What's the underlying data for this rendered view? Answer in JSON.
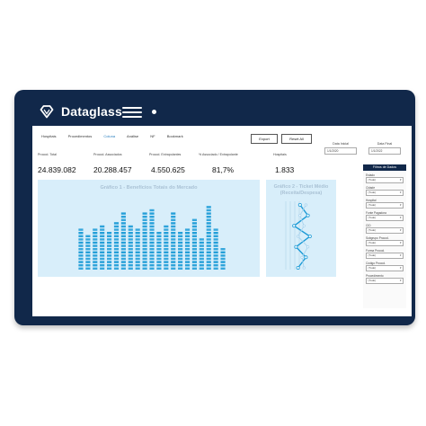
{
  "header": {
    "brand": "Dataglass"
  },
  "nav": {
    "items": [
      "Hospitais",
      "Procedimentos",
      "Coluna",
      "Análise",
      "NF",
      "Bookmark"
    ]
  },
  "toolbar": {
    "export_label": "Export",
    "reset_label": "Reset All"
  },
  "dates": {
    "start": {
      "label": "Data Inicial",
      "value": "1/1/2020"
    },
    "end": {
      "label": "Data Final",
      "value": "1/1/2022"
    }
  },
  "kpis": [
    {
      "label": "Procod. Total",
      "value": "24.839.082"
    },
    {
      "label": "Procod. Associados",
      "value": "20.288.457"
    },
    {
      "label": "Procod. Extrapolantes",
      "value": "4.550.625"
    },
    {
      "label": "% Associado / Extrapolante",
      "value": "81,7%"
    },
    {
      "label": "Hospitais",
      "value": "1.833"
    }
  ],
  "chart_data": [
    {
      "type": "bar",
      "title": "Gráfico 1 - Benefícios Totais do Mercado",
      "values": [
        16,
        13,
        15,
        17,
        14,
        18,
        22,
        17,
        15,
        21,
        23,
        14,
        17,
        21,
        14,
        16,
        19,
        12,
        24,
        15,
        8
      ],
      "ylim": [
        0,
        26
      ]
    },
    {
      "type": "line",
      "title": "Gráfico 2 - Ticket Médio (Receita/Despesa)",
      "series": [
        {
          "values": [
            0.45,
            0.65,
            0.3,
            0.7,
            0.35,
            0.6,
            0.4
          ]
        },
        {
          "values": [
            0.6,
            0.45,
            0.55,
            0.4,
            0.65,
            0.5,
            0.55
          ]
        }
      ],
      "ylim": [
        0,
        1
      ]
    }
  ],
  "filters": {
    "title": "Filtros de Dados",
    "items": [
      {
        "label": "Estado",
        "value": "(Tudo)"
      },
      {
        "label": "Cidade",
        "value": "(Tudo)"
      },
      {
        "label": "Hospital",
        "value": "(Tudo)"
      },
      {
        "label": "Fonte Pagadora",
        "value": "(Tudo)"
      },
      {
        "label": "CID",
        "value": "(Tudo)"
      },
      {
        "label": "Subgrupo Procod.",
        "value": "(Tudo)"
      },
      {
        "label": "Forma Procod.",
        "value": "(Tudo)"
      },
      {
        "label": "Código Procod.",
        "value": "(Tudo)"
      },
      {
        "label": "Procedimento",
        "value": "(Tudo)"
      }
    ]
  },
  "colors": {
    "navy": "#11284a",
    "bar_blue": "#1a9ad6",
    "panel": "#d8eefa"
  }
}
